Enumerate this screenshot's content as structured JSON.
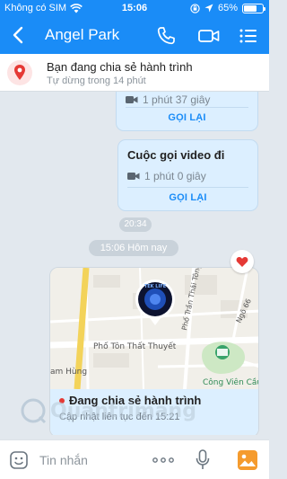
{
  "status_bar": {
    "carrier": "Không có SIM",
    "time": "15:06",
    "battery": "65%",
    "battery_level": 0.65
  },
  "header": {
    "contact_name": "Angel Park",
    "icons": [
      "back-icon",
      "phone-icon",
      "video-call-icon",
      "menu-icon"
    ]
  },
  "location_banner": {
    "title": "Bạn đang chia sẻ hành trình",
    "subtitle": "Tự dừng trong 14 phút"
  },
  "messages": {
    "call_1": {
      "duration": "1 phút 37 giây",
      "call_back_label": "GỌI LẠI"
    },
    "call_2": {
      "title": "Cuộc gọi video đi",
      "duration": "1 phút 0 giây",
      "call_back_label": "GỌI LẠI"
    },
    "time_stamp": "20:34",
    "day_separator": "15:06 Hôm nay",
    "location_card": {
      "map_labels": {
        "street_1": "Phố Tôn Thất Thuyết",
        "street_2": "Phố Trần Thái Tông",
        "street_3": "Ngõ 66",
        "street_4": "am Hùng",
        "park": "Công Viên Cầu Giấy",
        "avatar_text": "TEK LIFE"
      },
      "title": "Đang chia sẻ hành trình",
      "subtitle": "Cập nhật liên tục đến 15:21"
    }
  },
  "input_bar": {
    "placeholder": "Tin nhắn"
  },
  "watermark": "Quantrimang",
  "colors": {
    "accent": "#1a8cf7",
    "bubble": "#dcefff",
    "live_dot": "#e53935",
    "background": "#e2e8ee"
  }
}
